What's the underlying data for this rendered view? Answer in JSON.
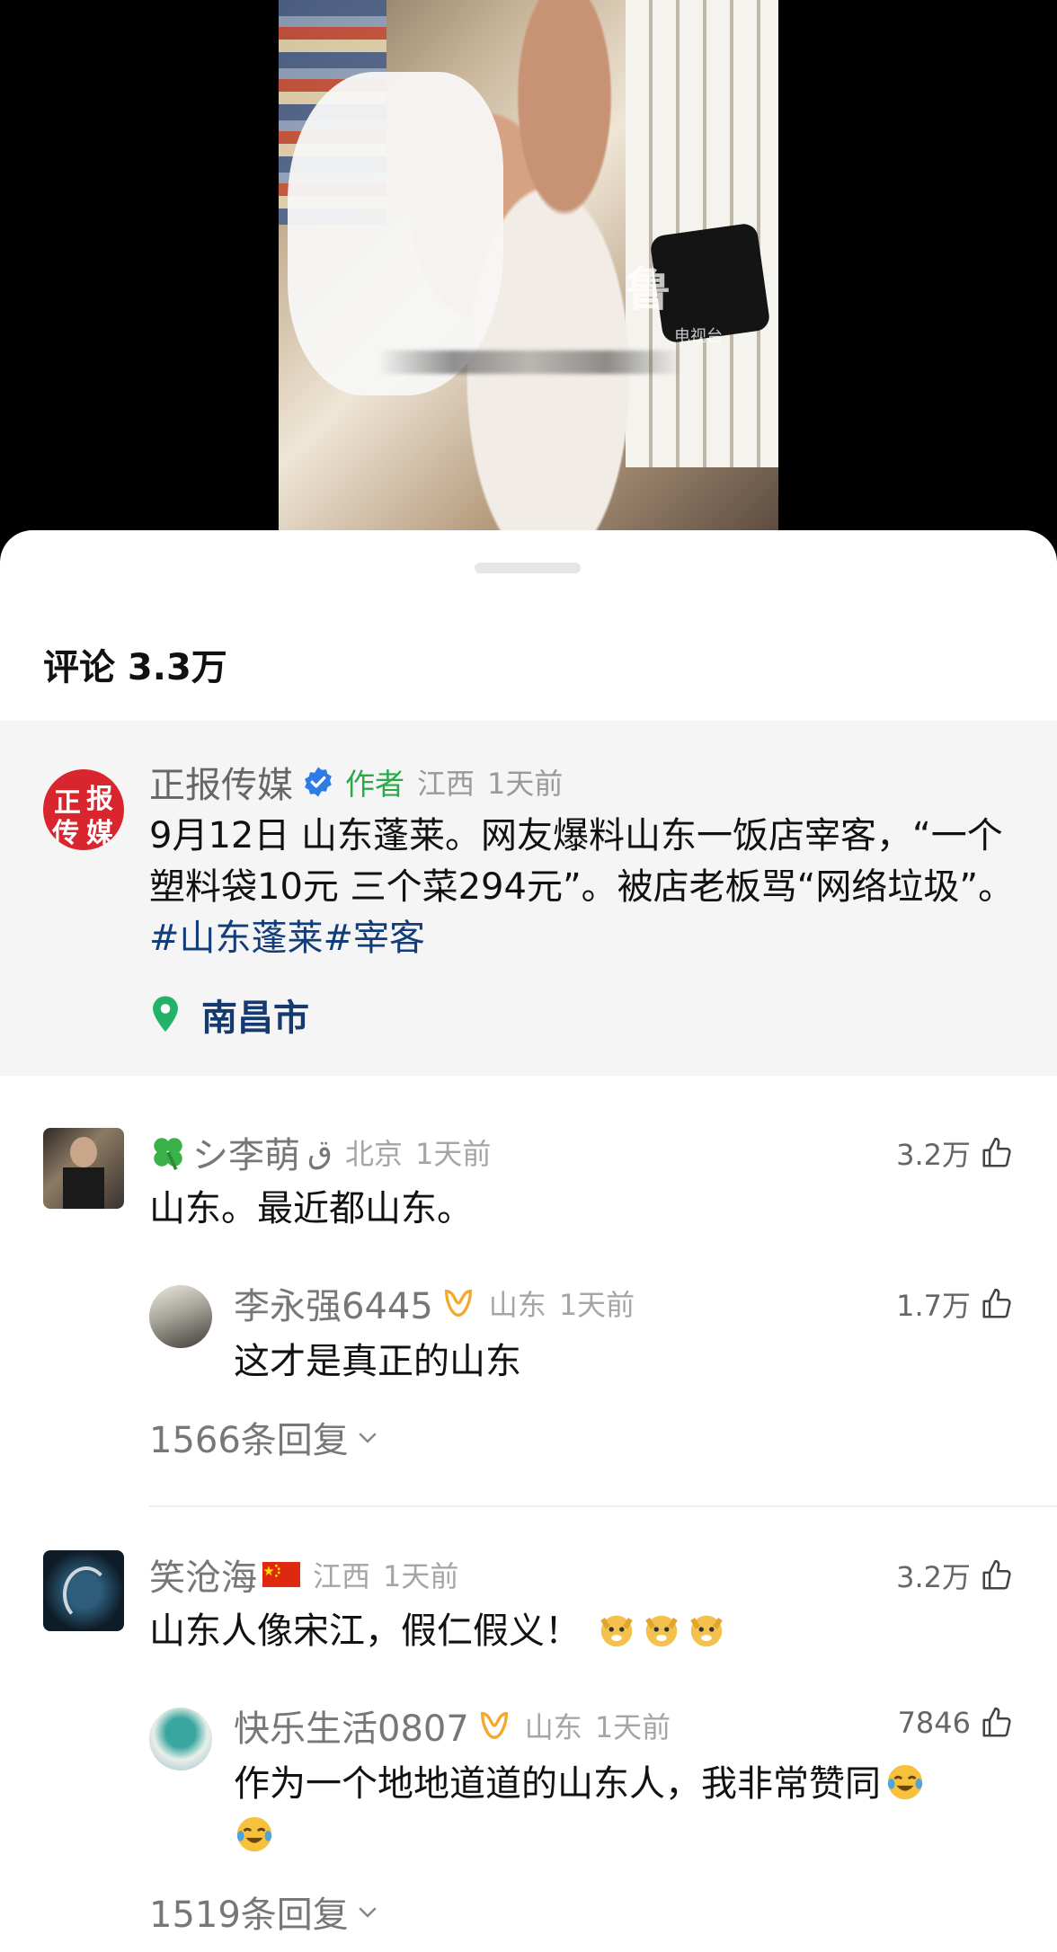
{
  "video": {
    "watermark": "鲁",
    "watermark_small": "电视台"
  },
  "comments_sheet": {
    "title": "评论 3.3万"
  },
  "author_post": {
    "username": "正报传媒",
    "author_tag": "作者",
    "region": "江西",
    "time": "1天前",
    "text_plain": "9月12日 山东蓬莱。网友爆料山东一饭店宰客，“一个塑料袋10元 三个菜294元”。被店老板骂“网络垃圾”。",
    "hashtags": "#山东蓬莱#宰客",
    "location": "南昌市",
    "logo_chars": [
      "正",
      "报",
      "传",
      "媒"
    ],
    "colors": {
      "logo_red": "#d9262e",
      "author_green": "#2aa84a",
      "link_blue": "#123d7a"
    }
  },
  "comments": [
    {
      "username": "シ李萌",
      "username_suffix": "ق",
      "region": "北京",
      "time": "1天前",
      "text": "山东。最近都山东。",
      "likes": "3.2万",
      "reply": {
        "username": "李永强6445",
        "region": "山东",
        "time": "1天前",
        "text": "这才是真正的山东",
        "likes": "1.7万"
      },
      "replies_label": "1566条回复"
    },
    {
      "username": "笑沧海",
      "region": "江西",
      "time": "1天前",
      "text": "山东人像宋江，假仁假义！",
      "likes": "3.2万",
      "reply": {
        "username": "快乐生活0807",
        "region": "山东",
        "time": "1天前",
        "text": "作为一个地地道道的山东人，我非常赞同",
        "likes": "7846"
      },
      "replies_label": "1519条回复"
    }
  ]
}
